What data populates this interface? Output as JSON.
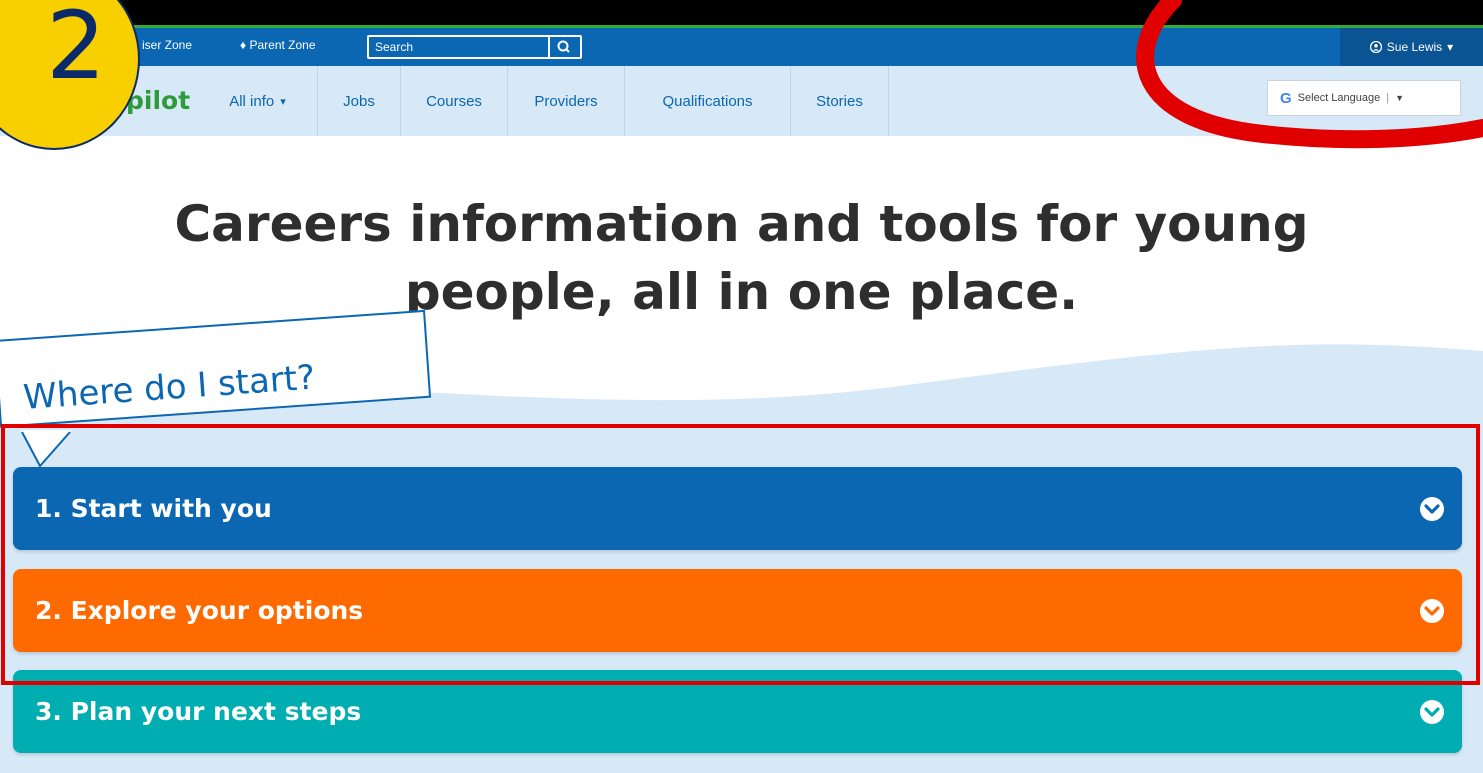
{
  "annotation": {
    "step_number": "2"
  },
  "utility_bar": {
    "adviser_zone": "iser Zone",
    "parent_zone": "Parent Zone",
    "search_placeholder": "Search",
    "user_name": "Sue Lewis"
  },
  "nav": {
    "logo_text": "pilot",
    "items": [
      "All info",
      "Jobs",
      "Courses",
      "Providers",
      "Qualifications",
      "Stories"
    ],
    "language_label": "Select Language"
  },
  "hero": {
    "headline_line1": "Careers information and tools for young",
    "headline_line2": "people, all in one place.",
    "bubble_text": "Where do I start?"
  },
  "accordions": [
    {
      "label": "1. Start with you",
      "color": "#0b67b2"
    },
    {
      "label": "2. Explore your options",
      "color": "#ff6a00"
    },
    {
      "label": "3. Plan your next steps",
      "color": "#00adb0"
    }
  ],
  "colors": {
    "brand_blue": "#0b67b2",
    "highlight_red": "#e00000",
    "badge_yellow": "#f8d000"
  }
}
